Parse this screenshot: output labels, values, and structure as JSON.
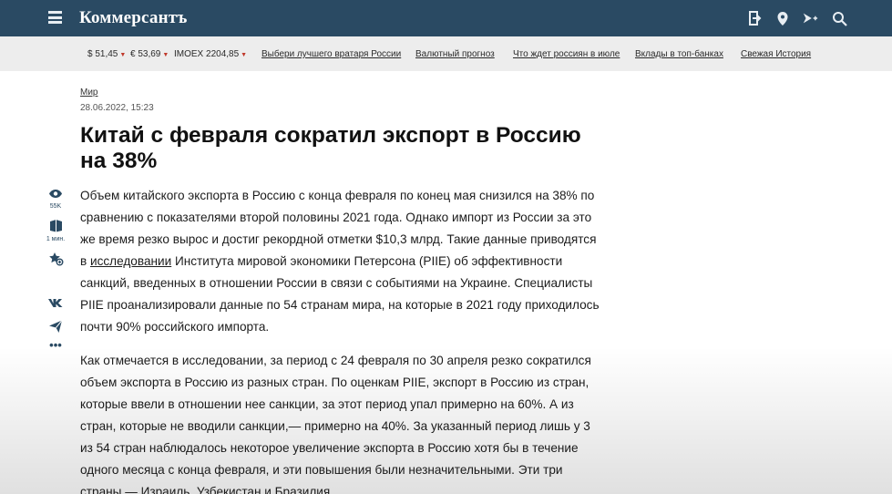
{
  "header": {
    "brand": "Коммерсантъ",
    "icons": [
      "menu-icon",
      "login-icon",
      "location-pin-icon",
      "subscribe-icon",
      "search-icon"
    ]
  },
  "quotes": {
    "usd": "$ 51,45",
    "eur": "€ 53,69",
    "imoex": "IMOEX 2204,85",
    "trend_color": "#c0392b"
  },
  "nav": {
    "link1": "Выбери лучшего вратаря России",
    "link2": "Валютный прогноз",
    "link3": "Что ждет россиян в июле",
    "link4": "Вклады в топ-банках",
    "link5": "Свежая История"
  },
  "article": {
    "rubric": "Мир",
    "date": "28.06.2022, 15:23",
    "title": "Китай с февраля сократил экспорт в Россию на 38%",
    "views": "55K",
    "read_time": "1 мин.",
    "p1_before": "Объем китайского экспорта в Россию с конца февраля по конец мая снизился на 38% по сравнению с показателями второй половины 2021 года. Однако импорт из России за это же время резко вырос и достиг рекордной отметки $10,3 млрд. Такие данные приводятся в ",
    "p1_link": "исследовании",
    "p1_after": " Института мировой экономики Петерсона (PIIE) об эффективности санкций, введенных в отношении России в связи с событиями на Украине. Специалисты PIIE проанализировали данные по 54 странам мира, на которые в 2021 году приходилось почти 90% российского импорта.",
    "p2": "Как отмечается в исследовании, за период с 24 февраля по 30 апреля резко сократился объем экспорта в Россию из разных стран. По оценкам PIIE, экспорт в Россию из стран, которые ввели в отношении нее санкции, за этот период упал примерно на 60%. А из стран, которые не вводили санкции,— примерно на 40%. За указанный период лишь у 3 из 54 стран наблюдалось некоторое увеличение экспорта в Россию хотя бы в течение одного месяца с конца февраля, и эти повышения были незначительными. Эти три страны — Израиль, Узбекистан и Бразилия."
  },
  "colors": {
    "header_bg": "#2a4a63",
    "infobar_bg": "#ededed",
    "accent": "#2a4a63"
  }
}
